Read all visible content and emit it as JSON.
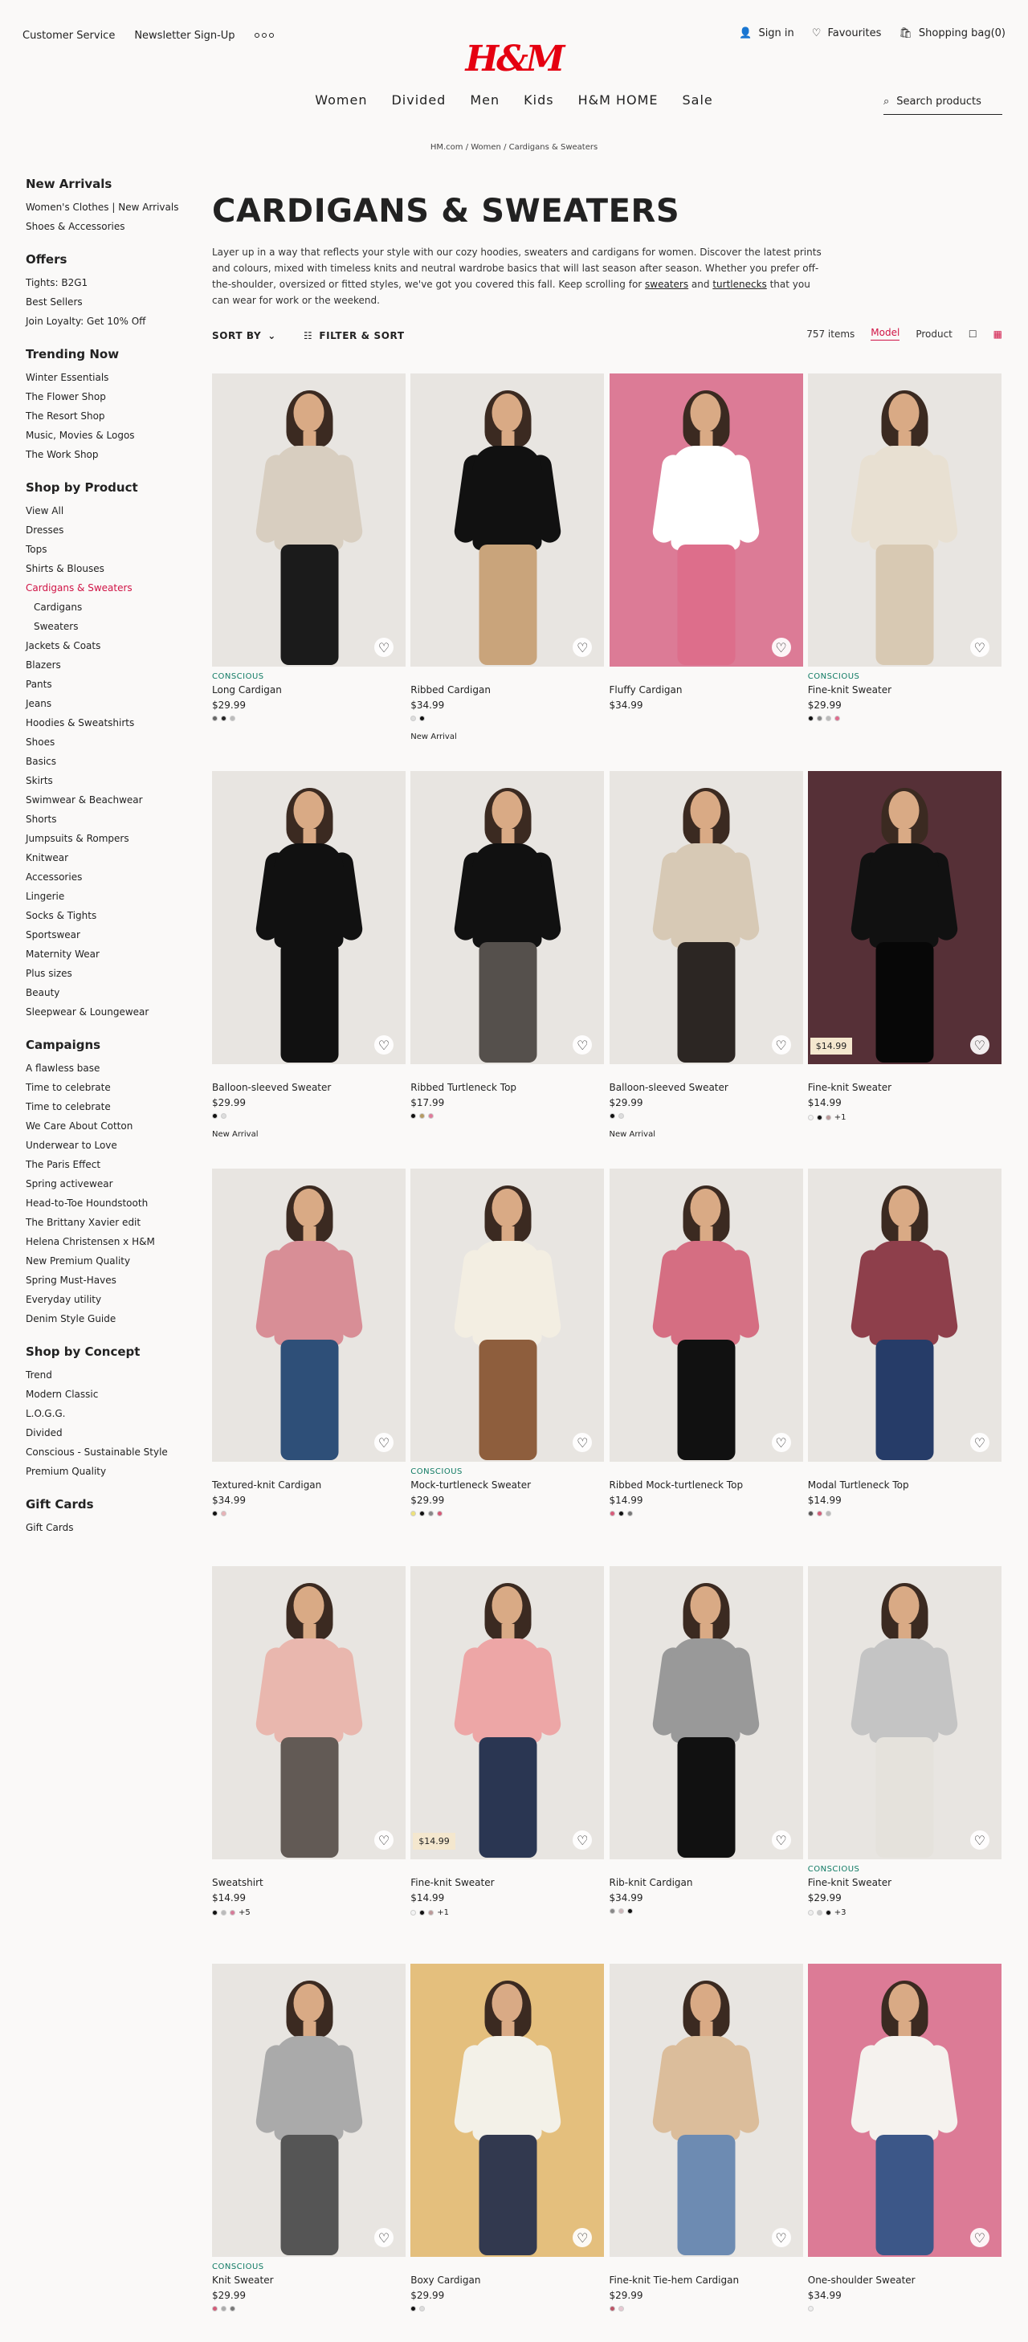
{
  "header": {
    "customer_service": "Customer Service",
    "newsletter": "Newsletter Sign-Up",
    "logo": "H&M",
    "sign_in": "Sign in",
    "favourites": "Favourites",
    "bag": "Shopping bag(0)",
    "search_placeholder": "Search products"
  },
  "nav": [
    "Women",
    "Divided",
    "Men",
    "Kids",
    "H&M HOME",
    "Sale"
  ],
  "breadcrumb": "HM.com / Women / Cardigans & Sweaters",
  "sidebar": [
    {
      "title": "New Arrivals",
      "items": [
        "Women's Clothes | New Arrivals",
        "Shoes & Accessories"
      ]
    },
    {
      "title": "Offers",
      "items": [
        "Tights: B2G1",
        "Best Sellers",
        "Join Loyalty: Get 10% Off"
      ]
    },
    {
      "title": "Trending Now",
      "items": [
        "Winter Essentials",
        "The Flower Shop",
        "The Resort Shop",
        "Music, Movies & Logos",
        "The Work Shop"
      ]
    },
    {
      "title": "Shop by Product",
      "items": [
        "View All",
        "Dresses",
        "Tops",
        "Shirts & Blouses",
        "Cardigans & Sweaters",
        "Cardigans",
        "Sweaters",
        "Jackets & Coats",
        "Blazers",
        "Pants",
        "Jeans",
        "Hoodies & Sweatshirts",
        "Shoes",
        "Basics",
        "Skirts",
        "Swimwear & Beachwear",
        "Shorts",
        "Jumpsuits & Rompers",
        "Knitwear",
        "Accessories",
        "Lingerie",
        "Socks & Tights",
        "Sportswear",
        "Maternity Wear",
        "Plus sizes",
        "Beauty",
        "Sleepwear & Loungewear"
      ]
    },
    {
      "title": "Campaigns",
      "items": [
        "A flawless base",
        "Time to celebrate",
        "Time to celebrate",
        "We Care About Cotton",
        "Underwear to Love",
        "The Paris Effect",
        "Spring activewear",
        "Head-to-Toe Houndstooth",
        "The Brittany Xavier edit",
        "Helena Christensen x H&M",
        "New Premium Quality",
        "Spring Must-Haves",
        "Everyday utility",
        "Denim Style Guide"
      ]
    },
    {
      "title": "Shop by Concept",
      "items": [
        "Trend",
        "Modern Classic",
        "L.O.G.G.",
        "Divided",
        "Conscious - Sustainable Style",
        "Premium Quality"
      ]
    },
    {
      "title": "Gift Cards",
      "items": [
        "Gift Cards"
      ]
    }
  ],
  "page": {
    "title": "CARDIGANS & SWEATERS",
    "intro_text": "Layer up in a way that reflects your style with our cozy hoodies, sweaters and cardigans for women. Discover the latest prints and colours, mixed with timeless knits and neutral wardrobe basics that will last season after season. Whether you prefer off-the-shoulder, oversized or fitted styles, we've got you covered this fall. Keep scrolling for ",
    "link_sweaters": "sweaters",
    "and": " and ",
    "link_turtlenecks": "turtlenecks",
    "intro_end": " that you can wear for work or the weekend.",
    "sort_by": "SORT BY",
    "filter_sort": "FILTER & SORT",
    "items_count": "757 items",
    "model": "Model",
    "product": "Product"
  },
  "products": [
    {
      "conscious": "CONSCIOUS",
      "name": "Long Cardigan",
      "price": "$29.99",
      "colors": [
        "#666",
        "#222",
        "#bbb"
      ]
    },
    {
      "conscious": "",
      "name": "Ribbed Cardigan",
      "price": "$34.99",
      "colors": [
        "#ddd",
        "#111"
      ],
      "badge": "New Arrival"
    },
    {
      "conscious": "",
      "name": "Fluffy Cardigan",
      "price": "$34.99",
      "colors": []
    },
    {
      "conscious": "CONSCIOUS",
      "name": "Fine-knit Sweater",
      "price": "$29.99",
      "colors": [
        "#111",
        "#888",
        "#bbb",
        "#e06b8d"
      ]
    },
    {
      "conscious": "",
      "name": "Balloon-sleeved Sweater",
      "price": "$29.99",
      "colors": [
        "#111",
        "#ddd"
      ],
      "badge": "New Arrival"
    },
    {
      "conscious": "",
      "name": "Ribbed Turtleneck Top",
      "price": "$17.99",
      "colors": [
        "#111",
        "#b59b62",
        "#e07b9a"
      ]
    },
    {
      "conscious": "",
      "name": "Balloon-sleeved Sweater",
      "price": "$29.99",
      "colors": [
        "#111",
        "#ddd"
      ],
      "badge": "New Arrival"
    },
    {
      "conscious": "",
      "name": "Fine-knit Sweater",
      "price": "$14.99",
      "colors": [
        "#f3f3f3",
        "#111",
        "#b99"
      ],
      "more": "+1",
      "price_badge": "$14.99"
    },
    {
      "conscious": "",
      "name": "Textured-knit Cardigan",
      "price": "$34.99",
      "colors": [
        "#111",
        "#e7b2b6"
      ]
    },
    {
      "conscious": "CONSCIOUS",
      "name": "Mock-turtleneck Sweater",
      "price": "$29.99",
      "colors": [
        "#eee27a",
        "#111",
        "#888",
        "#d55977"
      ]
    },
    {
      "conscious": "",
      "name": "Ribbed Mock-turtleneck Top",
      "price": "$14.99",
      "colors": [
        "#d85c7b",
        "#111",
        "#777"
      ]
    },
    {
      "conscious": "",
      "name": "Modal Turtleneck Top",
      "price": "$14.99",
      "colors": [
        "#555",
        "#d25c78",
        "#bbb"
      ]
    },
    {
      "conscious": "",
      "name": "Sweatshirt",
      "price": "$14.99",
      "colors": [
        "#111",
        "#bbb",
        "#d77b99"
      ],
      "more": "+5"
    },
    {
      "conscious": "",
      "name": "Fine-knit Sweater",
      "price": "$14.99",
      "colors": [
        "#f3f3f3",
        "#111",
        "#b99"
      ],
      "more": "+1",
      "price_badge": "$14.99"
    },
    {
      "conscious": "",
      "name": "Rib-knit Cardigan",
      "price": "$34.99",
      "colors": [
        "#888",
        "#ccb6b9",
        "#111"
      ]
    },
    {
      "conscious": "CONSCIOUS",
      "name": "Fine-knit Sweater",
      "price": "$29.99",
      "colors": [
        "#eee",
        "#ccc",
        "#111"
      ],
      "more": "+3"
    },
    {
      "conscious": "CONSCIOUS",
      "name": "Knit Sweater",
      "price": "$29.99",
      "colors": [
        "#d25c78",
        "#aaa",
        "#777"
      ]
    },
    {
      "conscious": "",
      "name": "Boxy Cardigan",
      "price": "$29.99",
      "colors": [
        "#111",
        "#ddd"
      ]
    },
    {
      "conscious": "",
      "name": "Fine-knit Tie-hem Cardigan",
      "price": "$29.99",
      "colors": [
        "#b56",
        "#e6c9d2"
      ]
    },
    {
      "conscious": "",
      "name": "One-shoulder Sweater",
      "price": "$34.99",
      "colors": [
        "#eee"
      ]
    }
  ]
}
